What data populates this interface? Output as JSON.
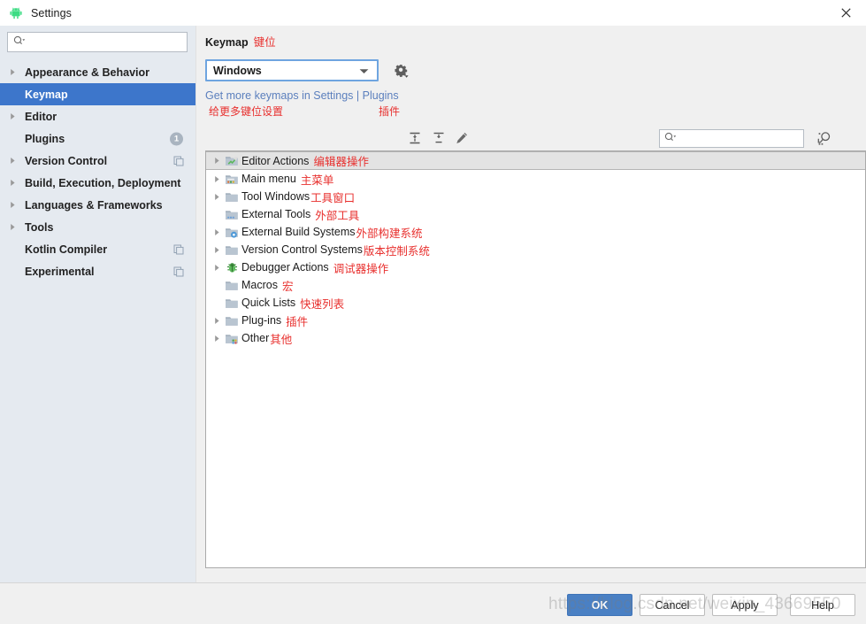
{
  "window": {
    "title": "Settings",
    "app_icon": "android-robot-icon",
    "close_label": "×"
  },
  "sidebar": {
    "search": {
      "placeholder": "",
      "value": "",
      "icon": "search-icon"
    },
    "items": [
      {
        "label": "Appearance & Behavior",
        "arrow": true,
        "selected": false,
        "badge": null,
        "copy_icon": false
      },
      {
        "label": "Keymap",
        "arrow": false,
        "selected": true,
        "badge": null,
        "copy_icon": false
      },
      {
        "label": "Editor",
        "arrow": true,
        "selected": false,
        "badge": null,
        "copy_icon": false
      },
      {
        "label": "Plugins",
        "arrow": false,
        "selected": false,
        "badge": "1",
        "copy_icon": false
      },
      {
        "label": "Version Control",
        "arrow": true,
        "selected": false,
        "badge": null,
        "copy_icon": true
      },
      {
        "label": "Build, Execution, Deployment",
        "arrow": true,
        "selected": false,
        "badge": null,
        "copy_icon": false
      },
      {
        "label": "Languages & Frameworks",
        "arrow": true,
        "selected": false,
        "badge": null,
        "copy_icon": false
      },
      {
        "label": "Tools",
        "arrow": true,
        "selected": false,
        "badge": null,
        "copy_icon": false
      },
      {
        "label": "Kotlin Compiler",
        "arrow": false,
        "selected": false,
        "badge": null,
        "copy_icon": true
      },
      {
        "label": "Experimental",
        "arrow": false,
        "selected": false,
        "badge": null,
        "copy_icon": true
      }
    ]
  },
  "content": {
    "header": {
      "title": "Keymap",
      "title_cn": "键位"
    },
    "keymap_select": {
      "value": "Windows",
      "caret_icon": "chevron-down-icon"
    },
    "gear_button": {
      "icon": "gear-icon"
    },
    "links": {
      "prefix": "Get more keymaps in ",
      "settings": "Settings",
      "separator": " | ",
      "plugins": "Plugins",
      "annotation_1": "给更多键位设置",
      "annotation_2": "插件"
    },
    "toolbar": {
      "expand_all": "expand-all-icon",
      "collapse_all": "collapse-all-icon",
      "edit": "edit-pencil-icon",
      "find_shortcut": "find-by-shortcut-icon"
    },
    "find": {
      "placeholder": "",
      "value": "",
      "icon": "search-icon"
    },
    "tree": [
      {
        "label": "Editor Actions",
        "cn": "编辑器操作",
        "arrow": true,
        "icon": "editor-actions-folder-icon",
        "selected": true,
        "tight": false
      },
      {
        "label": "Main menu",
        "cn": "主菜单",
        "arrow": true,
        "icon": "main-menu-folder-icon",
        "selected": false,
        "tight": false
      },
      {
        "label": "Tool Windows",
        "cn": "工具窗口",
        "arrow": true,
        "icon": "folder-icon",
        "selected": false,
        "tight": true
      },
      {
        "label": "External Tools",
        "cn": "外部工具",
        "arrow": false,
        "icon": "external-tools-folder-icon",
        "selected": false,
        "tight": false
      },
      {
        "label": "External Build Systems",
        "cn": "外部构建系统",
        "arrow": true,
        "icon": "build-systems-folder-icon",
        "selected": false,
        "tight": true
      },
      {
        "label": "Version Control Systems",
        "cn": "版本控制系统",
        "arrow": true,
        "icon": "folder-icon",
        "selected": false,
        "tight": true
      },
      {
        "label": "Debugger Actions",
        "cn": "调试器操作",
        "arrow": true,
        "icon": "debugger-bug-icon",
        "selected": false,
        "tight": false
      },
      {
        "label": "Macros",
        "cn": "宏",
        "arrow": false,
        "icon": "folder-icon",
        "selected": false,
        "tight": false
      },
      {
        "label": "Quick Lists",
        "cn": "快速列表",
        "arrow": false,
        "icon": "folder-icon",
        "selected": false,
        "tight": false
      },
      {
        "label": "Plug-ins",
        "cn": "插件",
        "arrow": true,
        "icon": "folder-icon",
        "selected": false,
        "tight": false
      },
      {
        "label": "Other",
        "cn": "其他",
        "arrow": true,
        "icon": "other-folder-icon",
        "selected": false,
        "tight": true
      }
    ]
  },
  "footer": {
    "ok": "OK",
    "cancel": "Cancel",
    "apply": "Apply",
    "help": "Help",
    "watermark": "https://blog.csdn.net/weixin_43669550"
  },
  "colors": {
    "sidebar_bg": "#e5eaf0",
    "selection_blue": "#3d76cb",
    "accent_red": "#e8302e",
    "link_blue": "#5b7fbd",
    "ok_button": "#4a80c4"
  }
}
